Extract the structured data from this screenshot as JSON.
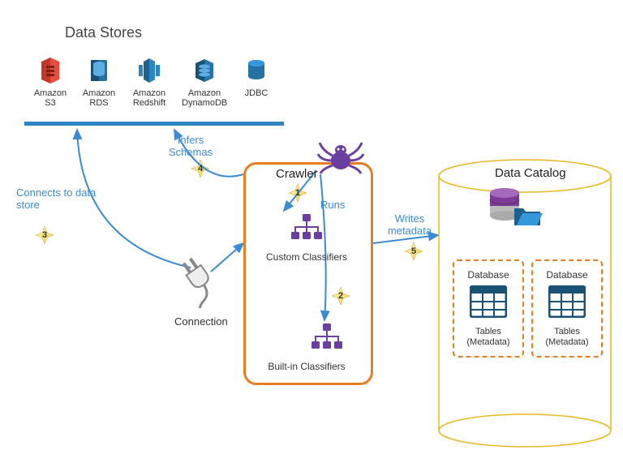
{
  "titles": {
    "data_stores": "Data Stores",
    "crawler": "Crawler",
    "data_catalog": "Data Catalog"
  },
  "stores": {
    "s3": "Amazon S3",
    "rds": "Amazon RDS",
    "redshift": "Amazon Redshift",
    "dynamodb": "Amazon DynamoDB",
    "jdbc": "JDBC"
  },
  "steps": {
    "s1": "1",
    "s2": "2",
    "s3": "3",
    "s4": "4",
    "s5": "5"
  },
  "labels": {
    "connects": "Connects to data store",
    "infers": "Infers Schemas",
    "runs": "Runs",
    "writes": "Writes metadata",
    "connection": "Connection",
    "custom": "Custom Classifiers",
    "builtin": "Built-in Classifiers"
  },
  "catalog": {
    "db_label": "Database",
    "tables_label": "Tables (Metadata)"
  }
}
